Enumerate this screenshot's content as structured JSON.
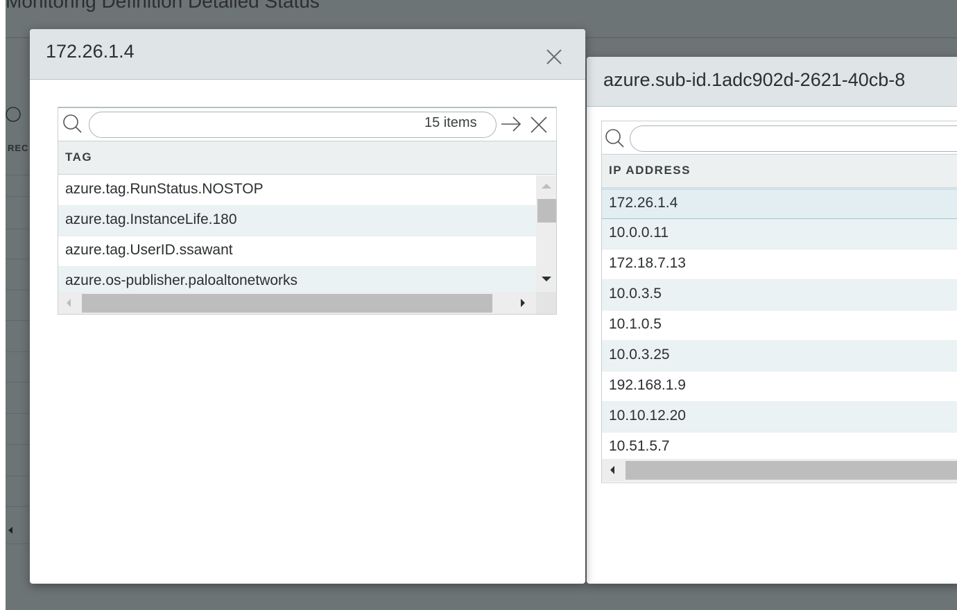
{
  "background_page": {
    "title": "Monitoring Definition Detailed Status",
    "column_label_partial": "REC"
  },
  "dialog_tags": {
    "title": "172.26.1.4",
    "grid": {
      "search_value": "",
      "items_count": "15 items",
      "column_header": "TAG",
      "rows": [
        "azure.tag.RunStatus.NOSTOP",
        "azure.tag.InstanceLife.180",
        "azure.tag.UserID.ssawant",
        "azure.os-publisher.paloaltonetworks"
      ]
    }
  },
  "dialog_ips": {
    "title": "azure.sub-id.1adc902d-2621-40cb-8",
    "grid": {
      "search_value": "",
      "column_header": "IP ADDRESS",
      "rows": [
        "172.26.1.4",
        "10.0.0.11",
        "172.18.7.13",
        "10.0.3.5",
        "10.1.0.5",
        "10.0.3.25",
        "192.168.1.9",
        "10.10.12.20",
        "10.51.5.7"
      ],
      "selected_row": "172.26.1.4"
    }
  },
  "icons": {
    "search": "search-icon",
    "close": "close-icon",
    "go": "arrow-right-icon",
    "clear": "clear-icon"
  },
  "colors": {
    "header_bg": "#dfe5e6",
    "overlay": "#6d7476",
    "row_alt": "#ebf2f4"
  }
}
